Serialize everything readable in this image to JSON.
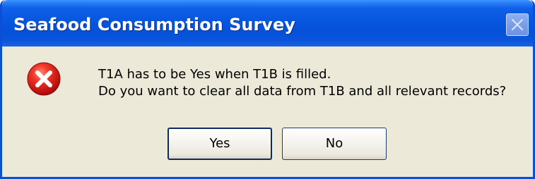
{
  "window": {
    "title": "Seafood Consumption Survey"
  },
  "icons": {
    "close": "close-icon",
    "error": "error-icon"
  },
  "message": {
    "line1": "T1A has to be Yes when T1B is filled.",
    "line2": "Do you want to clear all data from T1B and all relevant records?"
  },
  "buttons": {
    "yes_label": "Yes",
    "no_label": "No"
  },
  "colors": {
    "titlebar": "#0756de",
    "dialog_bg": "#ece9d8",
    "error_red": "#d81e1e"
  }
}
